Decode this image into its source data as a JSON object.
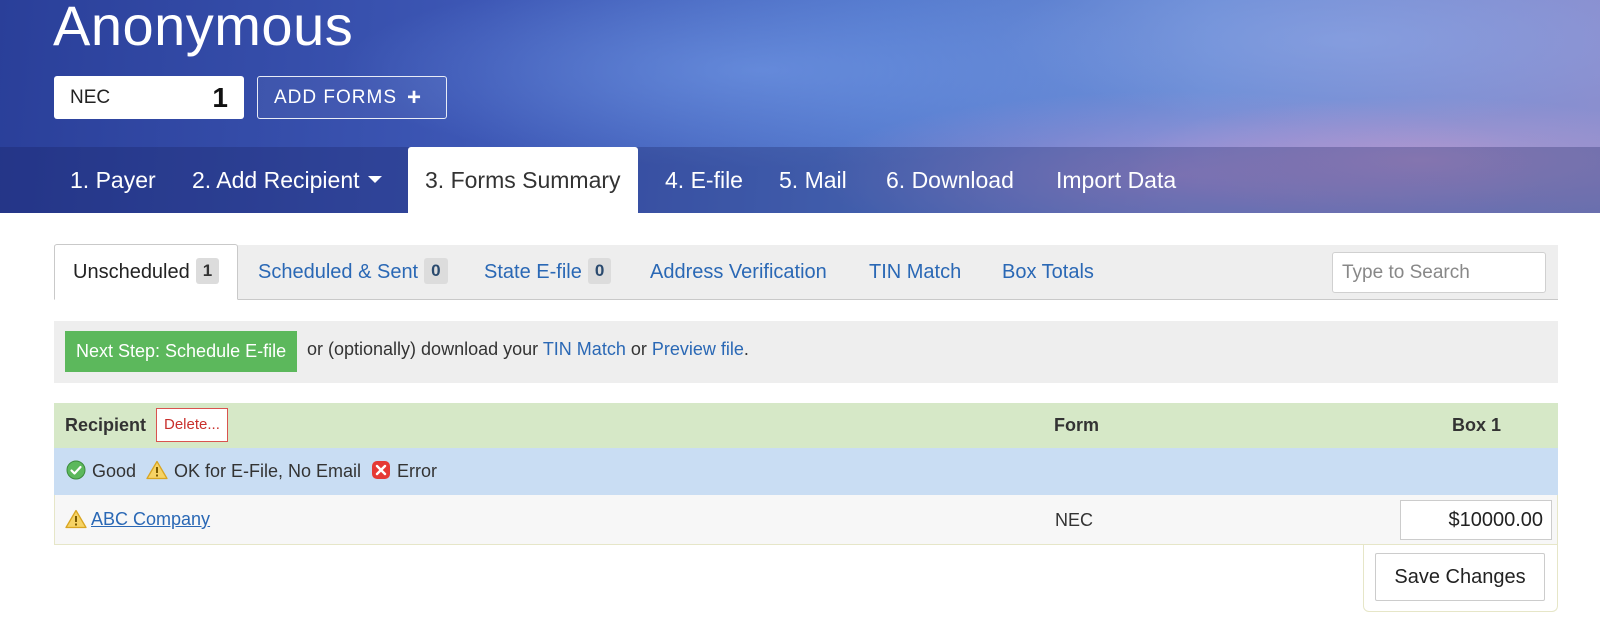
{
  "header": {
    "title": "Anonymous",
    "form_code": "NEC",
    "form_count": "1",
    "add_forms_label": "ADD FORMS"
  },
  "nav": {
    "items": [
      {
        "label": "1. Payer"
      },
      {
        "label": "2. Add Recipient"
      },
      {
        "label": "3. Forms Summary"
      },
      {
        "label": "4. E-file"
      },
      {
        "label": "5. Mail"
      },
      {
        "label": "6. Download"
      },
      {
        "label": "Import Data"
      }
    ],
    "active": "3. Forms Summary"
  },
  "tabs": {
    "items": [
      {
        "label": "Unscheduled",
        "badge": "1"
      },
      {
        "label": "Scheduled & Sent",
        "badge": "0"
      },
      {
        "label": "State E-file",
        "badge": "0"
      },
      {
        "label": "Address Verification"
      },
      {
        "label": "TIN Match"
      },
      {
        "label": "Box Totals"
      }
    ],
    "search_placeholder": "Type to Search"
  },
  "step": {
    "button_label": "Next Step: Schedule E-file",
    "text_before": "or (optionally) download your ",
    "link1": "TIN Match",
    "text_middle": " or ",
    "link2": "Preview file",
    "text_after": "."
  },
  "table": {
    "headers": {
      "recipient": "Recipient",
      "delete_label": "Delete...",
      "form": "Form",
      "box1": "Box 1"
    },
    "legend": {
      "good": "Good",
      "ok": "OK for E-File, No Email",
      "error": "Error"
    },
    "rows": [
      {
        "recipient": "ABC Company",
        "form": "NEC",
        "box1": "$10000.00",
        "status": "warning-icon"
      }
    ],
    "save_label": "Save Changes"
  },
  "colors": {
    "accent_link": "#2a68b5",
    "next_step_green": "#5cb85c",
    "header_row": "#d6e8c7",
    "legend_row": "#c9ddf3",
    "delete_red": "#d9534f"
  }
}
